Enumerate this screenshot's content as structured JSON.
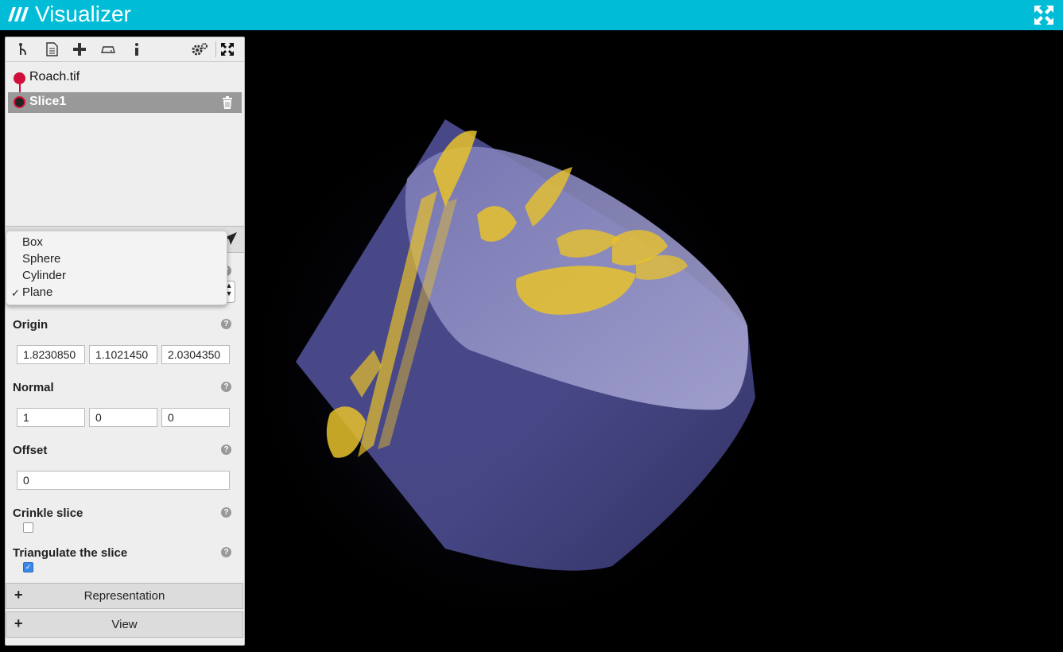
{
  "app": {
    "title": "Visualizer"
  },
  "pipeline": {
    "items": [
      {
        "label": "Roach.tif",
        "selected": false
      },
      {
        "label": "Slice1",
        "selected": true
      }
    ]
  },
  "slice_type_dropdown": {
    "options": [
      "Box",
      "Sphere",
      "Cylinder",
      "Plane"
    ],
    "selected": "Plane"
  },
  "properties": {
    "origin": {
      "label": "Origin",
      "values": [
        "1.8230850",
        "1.1021450",
        "2.0304350"
      ]
    },
    "normal": {
      "label": "Normal",
      "values": [
        "1",
        "0",
        "0"
      ]
    },
    "offset": {
      "label": "Offset",
      "value": "0"
    },
    "crinkle": {
      "label": "Crinkle slice",
      "checked": false
    },
    "triangulate": {
      "label": "Triangulate the slice",
      "checked": true
    }
  },
  "sections": {
    "representation": "Representation",
    "view": "View"
  },
  "colors": {
    "topbar": "#00bcd6",
    "accent": "#d0103a",
    "volume": "#5a58a0",
    "feature": "#e8c22a"
  }
}
